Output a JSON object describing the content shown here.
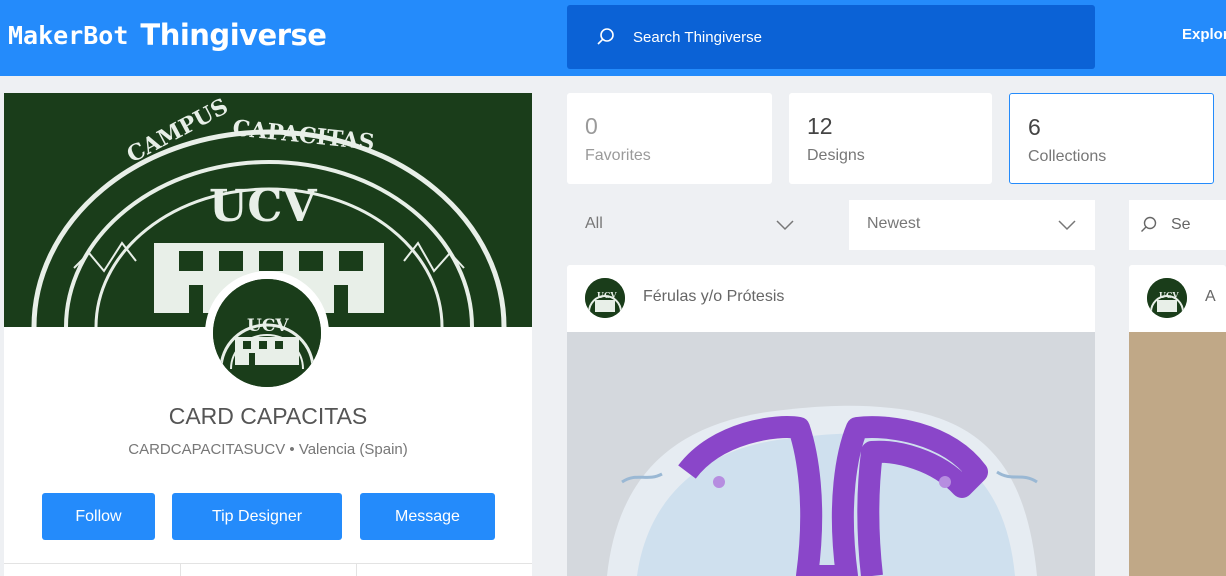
{
  "header": {
    "brand_maker": "MakerBot",
    "brand_thing": "Thingiverse",
    "search_placeholder": "Search Thingiverse",
    "explore": "Explore"
  },
  "profile": {
    "name": "CARD CAPACITAS",
    "username": "CARDCAPACITASUCV",
    "separator": "•",
    "location": "Valencia (Spain)",
    "buttons": {
      "follow": "Follow",
      "tip": "Tip Designer",
      "message": "Message"
    }
  },
  "stats": [
    {
      "count": "0",
      "label": "Favorites"
    },
    {
      "count": "12",
      "label": "Designs"
    },
    {
      "count": "6",
      "label": "Collections"
    }
  ],
  "filters": {
    "type": "All",
    "sort": "Newest",
    "search_partial": "Se"
  },
  "cards": [
    {
      "title": "Férulas y/o Prótesis"
    },
    {
      "title": "A"
    }
  ],
  "colors": {
    "accent": "#248bfb",
    "search_bg": "#0b62d6",
    "banner": "#1a3d1a"
  }
}
